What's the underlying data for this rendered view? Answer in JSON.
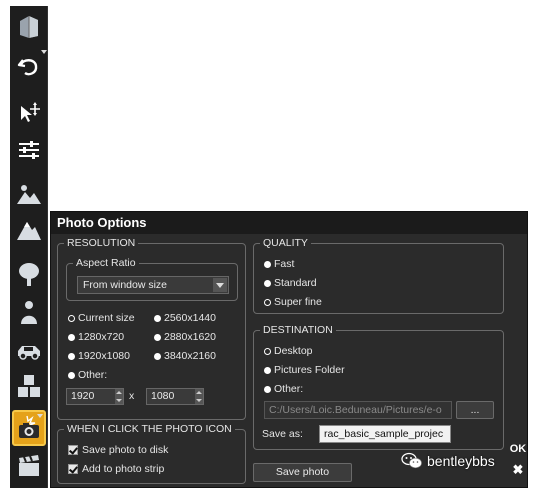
{
  "toolbar": {
    "items": [
      {
        "icon": "building-icon"
      },
      {
        "icon": "undo-icon"
      },
      {
        "icon": "select-move-icon"
      },
      {
        "icon": "sliders-icon"
      },
      {
        "icon": "terrain-icon"
      },
      {
        "icon": "mountain-icon"
      },
      {
        "icon": "tree-icon"
      },
      {
        "icon": "person-icon"
      },
      {
        "icon": "car-icon"
      },
      {
        "icon": "objects-icon"
      },
      {
        "icon": "camera-icon",
        "active": true
      },
      {
        "icon": "clapperboard-icon"
      }
    ],
    "active_color": "#e5a21a"
  },
  "panel": {
    "title": "Photo Options",
    "resolution": {
      "legend": "RESOLUTION",
      "aspect_ratio_legend": "Aspect Ratio",
      "aspect_ratio_value": "From window size",
      "options": [
        {
          "label": "Current size",
          "selected": false
        },
        {
          "label": "2560x1440",
          "selected": true
        },
        {
          "label": "1280x720",
          "selected": true
        },
        {
          "label": "2880x1620",
          "selected": true
        },
        {
          "label": "1920x1080",
          "selected": true
        },
        {
          "label": "3840x2160",
          "selected": true
        },
        {
          "label": "Other:",
          "selected": true
        }
      ],
      "width": "1920",
      "separator": "x",
      "height": "1080"
    },
    "click_icon": {
      "legend": "WHEN I CLICK THE PHOTO ICON",
      "save_to_disk": "Save photo to disk",
      "add_to_strip": "Add to photo strip"
    },
    "quality": {
      "legend": "QUALITY",
      "options": [
        {
          "label": "Fast",
          "selected": true
        },
        {
          "label": "Standard",
          "selected": true
        },
        {
          "label": "Super fine",
          "selected": false
        }
      ]
    },
    "destination": {
      "legend": "DESTINATION",
      "options": [
        {
          "label": "Desktop",
          "selected": false
        },
        {
          "label": "Pictures Folder",
          "selected": true
        },
        {
          "label": "Other:",
          "selected": true
        }
      ],
      "path": "C:/Users/Loic.Beduneau/Pictures/e-o",
      "browse_label": "...",
      "save_as_label": "Save as:",
      "save_as_value": "rac_basic_sample_projec"
    },
    "save_photo_label": "Save photo",
    "ok_label": "OK",
    "close_label": "✖"
  },
  "watermark": {
    "text": "bentleybbs"
  }
}
